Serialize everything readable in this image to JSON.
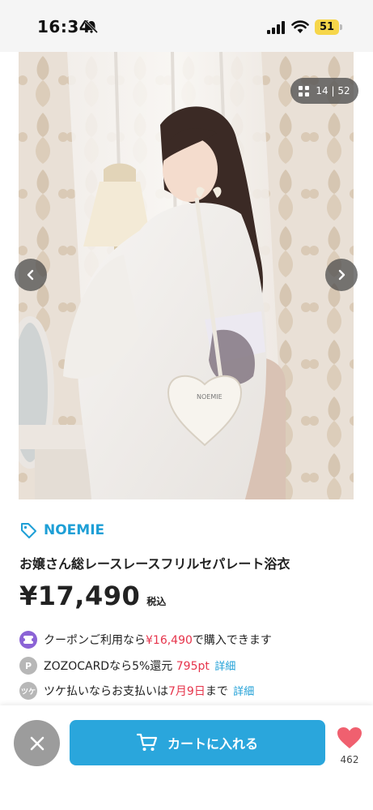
{
  "status_bar": {
    "time": "16:34",
    "battery": "51",
    "icons": [
      "bell-slash-icon",
      "signal-icon",
      "wifi-icon",
      "battery-icon"
    ]
  },
  "gallery": {
    "counter": "14 | 52",
    "icons": [
      "grid-icon",
      "chevron-left-icon",
      "chevron-right-icon"
    ],
    "photo_logo_text": "NOEMIE"
  },
  "product": {
    "brand": "NOEMIE",
    "title": "お嬢さん総レースレースフリルセパレート浴衣",
    "price": "¥17,490",
    "tax_label": "税込"
  },
  "offers": {
    "coupon": {
      "prefix": "クーポンご利用なら",
      "price": "¥16,490",
      "suffix": "で購入できます"
    },
    "zozocard": {
      "badge": "P",
      "prefix": "ZOZOCARDなら5%還元 ",
      "points": "795pt",
      "link": "詳細"
    },
    "tsuke": {
      "badge": "ツケ",
      "prefix": "ツケ払いならお支払いは",
      "date": "7月9日",
      "suffix": "まで",
      "link": "詳細"
    }
  },
  "bottom_bar": {
    "cart_label": "カートに入れる",
    "favorite_count": "462"
  },
  "colors": {
    "accent": "#2aa6dc",
    "brand_blue": "#1e9fd6",
    "sale_red": "#e6344b",
    "heart": "#f0606f",
    "coupon_purple": "#8b63d6",
    "battery_yellow": "#f6d64a"
  }
}
